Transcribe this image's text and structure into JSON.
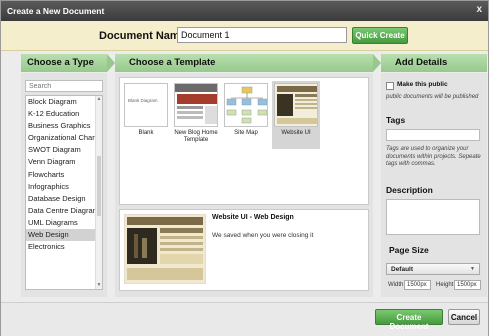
{
  "window": {
    "title": "Create a New Document",
    "close_glyph": "x"
  },
  "name_bar": {
    "label": "Document Name",
    "value": "Document 1",
    "quick_create": "Quick Create"
  },
  "sections": {
    "type": "Choose a Type",
    "template": "Choose a Template",
    "details": "Add Details"
  },
  "type_panel": {
    "search_placeholder": "Search",
    "items": [
      "Block Diagram",
      "K-12 Education",
      "Business Graphics",
      "Organizational Charts",
      "SWOT Diagram",
      "Venn Diagram",
      "Flowcharts",
      "Infographics",
      "Database Design",
      "Data Centre Diagrams",
      "UML Diagrams",
      "Web Design",
      "Electronics"
    ],
    "selected": "Web Design"
  },
  "templates": {
    "items": [
      {
        "label": "Blank",
        "thumb_text": "Blank Diagram"
      },
      {
        "label": "New Blog Home Template",
        "thumb_text": ""
      },
      {
        "label": "Site Map",
        "thumb_text": ""
      },
      {
        "label": "Website UI",
        "thumb_text": ""
      }
    ],
    "selected": "Website UI"
  },
  "preview": {
    "title": "Website UI - Web Design",
    "description": "We saved when you were closing it"
  },
  "details": {
    "make_public_label": "Make this public",
    "make_public_note": "public documents will be published",
    "tags_label": "Tags",
    "tags_note": "Tags are used to organize your documents within projects. Sepeate tags with commas.",
    "description_label": "Description",
    "page_size_label": "Page Size",
    "page_size_value": "Default",
    "width_label": "Width",
    "width_value": "1500px",
    "height_label": "Height",
    "height_value": "1500px"
  },
  "footer": {
    "create": "Create Document",
    "cancel": "Cancel"
  },
  "colors": {
    "accent_green": "#449a3c",
    "header_green": "#96c98b",
    "name_bar_bg": "#f5eecd",
    "title_bar": "#3b3b3b"
  }
}
